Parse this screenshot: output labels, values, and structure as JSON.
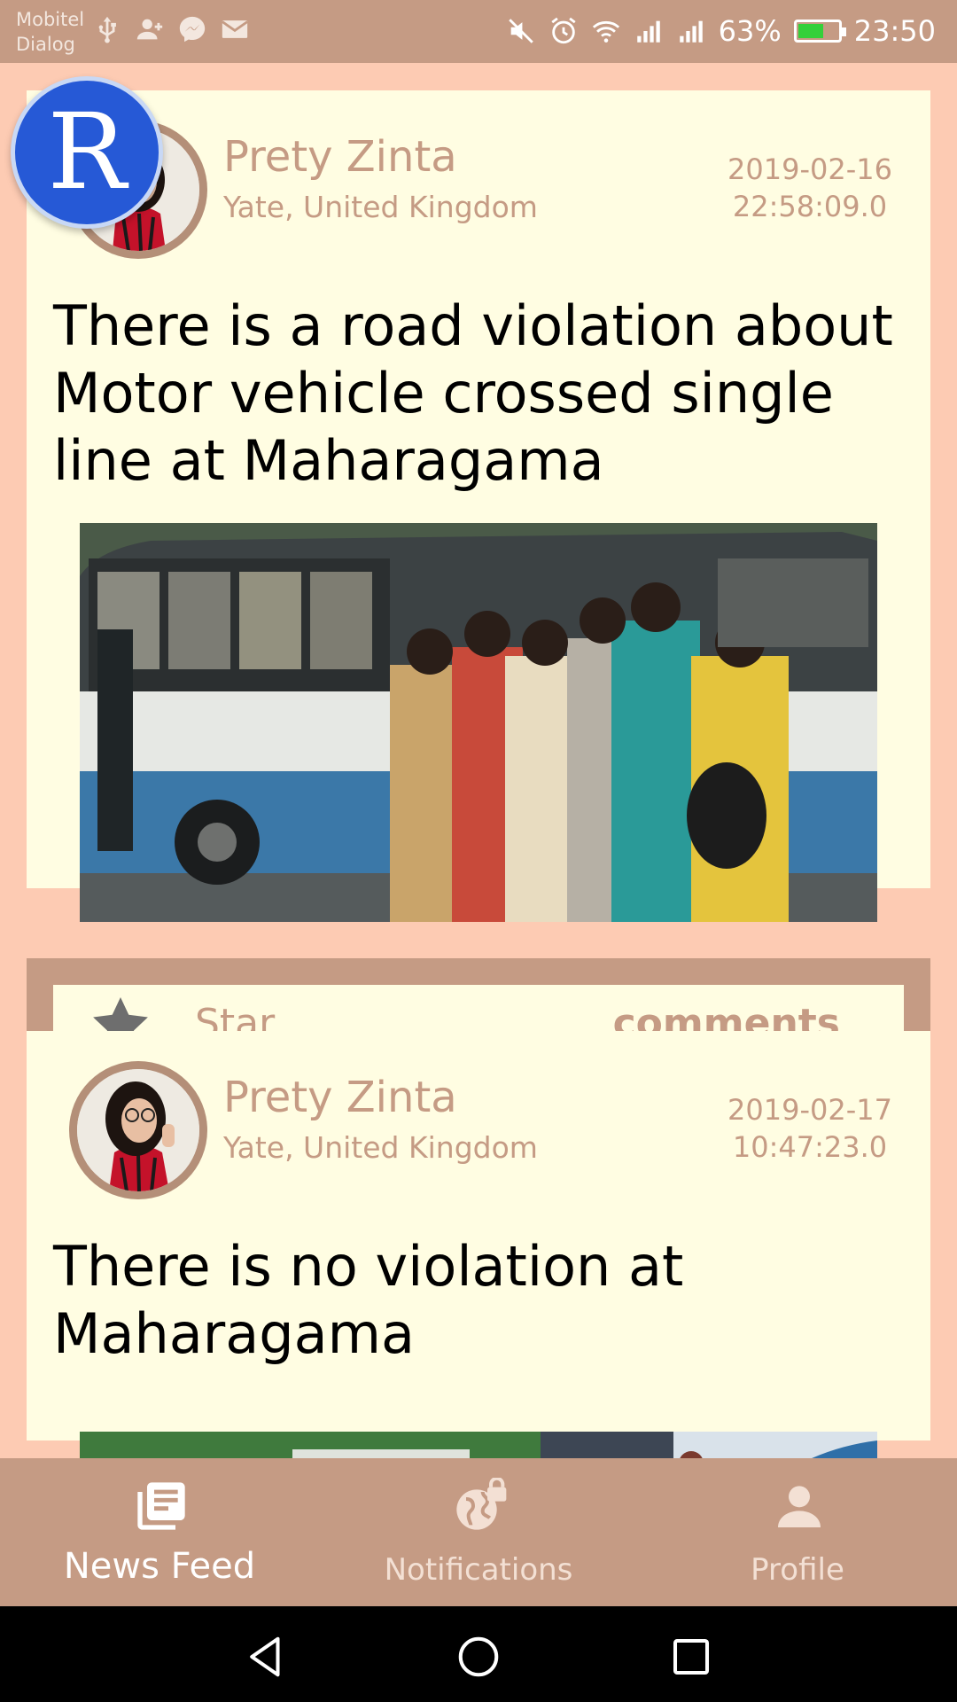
{
  "status_bar": {
    "carrier_line1": "Mobitel",
    "carrier_line2": "Dialog",
    "battery_percent": "63%",
    "battery_level": 0.63,
    "time": "23:50",
    "left_icons": [
      "usb-icon",
      "add-person-icon",
      "messenger-icon",
      "mail-icon"
    ],
    "right_icons": [
      "mute-icon",
      "alarm-icon",
      "wifi-icon",
      "signal-icon",
      "signal-icon"
    ]
  },
  "floating_badge": {
    "letter": "R"
  },
  "posts": [
    {
      "author": "Prety Zinta",
      "location": "Yate, United Kingdom",
      "date": "2019-02-16",
      "time": "22:58:09.0",
      "text": "There is a road violation about Motor vehicle crossed single line at Maharagama",
      "image": "bus-crowd-photo"
    },
    {
      "author": "Prety Zinta",
      "location": "Yate, United Kingdom",
      "date": "2019-02-17",
      "time": "10:47:23.0",
      "text": "There is no violation at Maharagama",
      "image": "street-bus-photo"
    }
  ],
  "actions": {
    "star_label": "Star",
    "comments_label": "comments"
  },
  "bottom_nav": {
    "items": [
      {
        "label": "News Feed",
        "icon": "news-feed-icon",
        "active": true
      },
      {
        "label": "Notifications",
        "icon": "globe-lock-icon",
        "active": false
      },
      {
        "label": "Profile",
        "icon": "person-icon",
        "active": false
      }
    ]
  },
  "colors": {
    "background": "#fdcbb3",
    "accent": "#c59b84",
    "card": "#fffde2",
    "badge_blue": "#2659d6"
  }
}
